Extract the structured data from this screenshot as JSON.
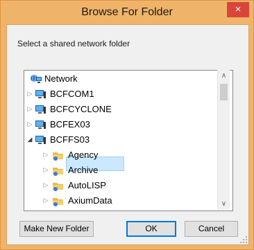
{
  "window": {
    "title": "Browse For Folder",
    "close_label": "×"
  },
  "instruction": "Select a shared network folder",
  "tree": {
    "root": {
      "label": "Network",
      "icon": "network-icon"
    },
    "items": [
      {
        "label": "BCFCOM1",
        "expanded": false,
        "icon": "computer-icon"
      },
      {
        "label": "BCFCYCLONE",
        "expanded": false,
        "icon": "computer-icon"
      },
      {
        "label": "BCFEX03",
        "expanded": false,
        "icon": "computer-icon"
      },
      {
        "label": "BCFFS03",
        "expanded": true,
        "icon": "computer-icon",
        "children": [
          {
            "label": "Agency",
            "icon": "shared-folder-icon"
          },
          {
            "label": "Archive",
            "icon": "shared-folder-icon",
            "selected": true
          },
          {
            "label": "AutoLISP",
            "icon": "shared-folder-icon"
          },
          {
            "label": "AxiumData",
            "icon": "shared-folder-icon"
          }
        ]
      }
    ]
  },
  "buttons": {
    "make_new_folder": "Make New Folder",
    "ok": "OK",
    "cancel": "Cancel"
  },
  "colors": {
    "title_bar": "#f0b36a",
    "close_button": "#d9453a",
    "selection": "#cce8ff",
    "default_button_border": "#0078d7"
  }
}
